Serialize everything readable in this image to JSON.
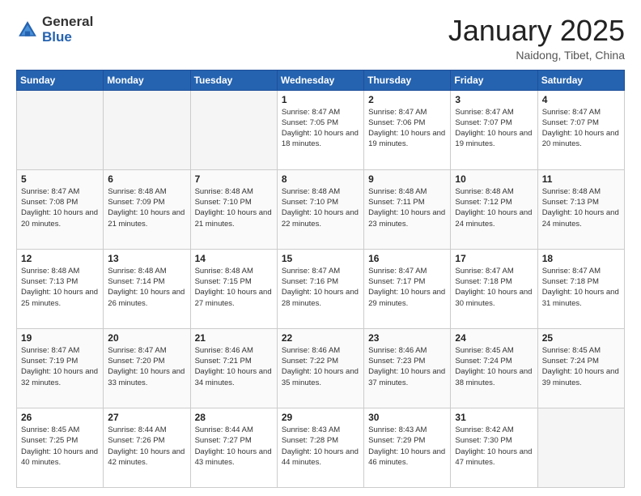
{
  "logo": {
    "general": "General",
    "blue": "Blue"
  },
  "header": {
    "month": "January 2025",
    "location": "Naidong, Tibet, China"
  },
  "weekdays": [
    "Sunday",
    "Monday",
    "Tuesday",
    "Wednesday",
    "Thursday",
    "Friday",
    "Saturday"
  ],
  "weeks": [
    [
      {
        "day": "",
        "info": ""
      },
      {
        "day": "",
        "info": ""
      },
      {
        "day": "",
        "info": ""
      },
      {
        "day": "1",
        "info": "Sunrise: 8:47 AM\nSunset: 7:05 PM\nDaylight: 10 hours and 18 minutes."
      },
      {
        "day": "2",
        "info": "Sunrise: 8:47 AM\nSunset: 7:06 PM\nDaylight: 10 hours and 19 minutes."
      },
      {
        "day": "3",
        "info": "Sunrise: 8:47 AM\nSunset: 7:07 PM\nDaylight: 10 hours and 19 minutes."
      },
      {
        "day": "4",
        "info": "Sunrise: 8:47 AM\nSunset: 7:07 PM\nDaylight: 10 hours and 20 minutes."
      }
    ],
    [
      {
        "day": "5",
        "info": "Sunrise: 8:47 AM\nSunset: 7:08 PM\nDaylight: 10 hours and 20 minutes."
      },
      {
        "day": "6",
        "info": "Sunrise: 8:48 AM\nSunset: 7:09 PM\nDaylight: 10 hours and 21 minutes."
      },
      {
        "day": "7",
        "info": "Sunrise: 8:48 AM\nSunset: 7:10 PM\nDaylight: 10 hours and 21 minutes."
      },
      {
        "day": "8",
        "info": "Sunrise: 8:48 AM\nSunset: 7:10 PM\nDaylight: 10 hours and 22 minutes."
      },
      {
        "day": "9",
        "info": "Sunrise: 8:48 AM\nSunset: 7:11 PM\nDaylight: 10 hours and 23 minutes."
      },
      {
        "day": "10",
        "info": "Sunrise: 8:48 AM\nSunset: 7:12 PM\nDaylight: 10 hours and 24 minutes."
      },
      {
        "day": "11",
        "info": "Sunrise: 8:48 AM\nSunset: 7:13 PM\nDaylight: 10 hours and 24 minutes."
      }
    ],
    [
      {
        "day": "12",
        "info": "Sunrise: 8:48 AM\nSunset: 7:13 PM\nDaylight: 10 hours and 25 minutes."
      },
      {
        "day": "13",
        "info": "Sunrise: 8:48 AM\nSunset: 7:14 PM\nDaylight: 10 hours and 26 minutes."
      },
      {
        "day": "14",
        "info": "Sunrise: 8:48 AM\nSunset: 7:15 PM\nDaylight: 10 hours and 27 minutes."
      },
      {
        "day": "15",
        "info": "Sunrise: 8:47 AM\nSunset: 7:16 PM\nDaylight: 10 hours and 28 minutes."
      },
      {
        "day": "16",
        "info": "Sunrise: 8:47 AM\nSunset: 7:17 PM\nDaylight: 10 hours and 29 minutes."
      },
      {
        "day": "17",
        "info": "Sunrise: 8:47 AM\nSunset: 7:18 PM\nDaylight: 10 hours and 30 minutes."
      },
      {
        "day": "18",
        "info": "Sunrise: 8:47 AM\nSunset: 7:18 PM\nDaylight: 10 hours and 31 minutes."
      }
    ],
    [
      {
        "day": "19",
        "info": "Sunrise: 8:47 AM\nSunset: 7:19 PM\nDaylight: 10 hours and 32 minutes."
      },
      {
        "day": "20",
        "info": "Sunrise: 8:47 AM\nSunset: 7:20 PM\nDaylight: 10 hours and 33 minutes."
      },
      {
        "day": "21",
        "info": "Sunrise: 8:46 AM\nSunset: 7:21 PM\nDaylight: 10 hours and 34 minutes."
      },
      {
        "day": "22",
        "info": "Sunrise: 8:46 AM\nSunset: 7:22 PM\nDaylight: 10 hours and 35 minutes."
      },
      {
        "day": "23",
        "info": "Sunrise: 8:46 AM\nSunset: 7:23 PM\nDaylight: 10 hours and 37 minutes."
      },
      {
        "day": "24",
        "info": "Sunrise: 8:45 AM\nSunset: 7:24 PM\nDaylight: 10 hours and 38 minutes."
      },
      {
        "day": "25",
        "info": "Sunrise: 8:45 AM\nSunset: 7:24 PM\nDaylight: 10 hours and 39 minutes."
      }
    ],
    [
      {
        "day": "26",
        "info": "Sunrise: 8:45 AM\nSunset: 7:25 PM\nDaylight: 10 hours and 40 minutes."
      },
      {
        "day": "27",
        "info": "Sunrise: 8:44 AM\nSunset: 7:26 PM\nDaylight: 10 hours and 42 minutes."
      },
      {
        "day": "28",
        "info": "Sunrise: 8:44 AM\nSunset: 7:27 PM\nDaylight: 10 hours and 43 minutes."
      },
      {
        "day": "29",
        "info": "Sunrise: 8:43 AM\nSunset: 7:28 PM\nDaylight: 10 hours and 44 minutes."
      },
      {
        "day": "30",
        "info": "Sunrise: 8:43 AM\nSunset: 7:29 PM\nDaylight: 10 hours and 46 minutes."
      },
      {
        "day": "31",
        "info": "Sunrise: 8:42 AM\nSunset: 7:30 PM\nDaylight: 10 hours and 47 minutes."
      },
      {
        "day": "",
        "info": ""
      }
    ]
  ]
}
